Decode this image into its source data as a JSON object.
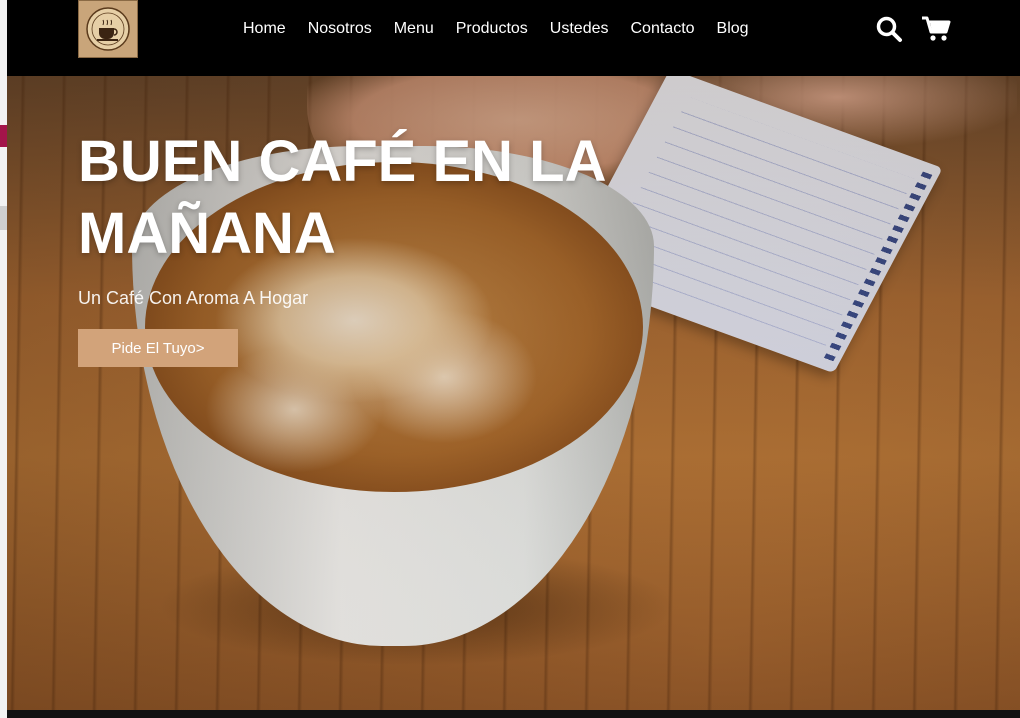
{
  "brand": {
    "logo_icon": "coffee-cup-logo"
  },
  "nav": {
    "items": [
      {
        "label": "Home"
      },
      {
        "label": "Nosotros"
      },
      {
        "label": "Menu"
      },
      {
        "label": "Productos"
      },
      {
        "label": "Ustedes"
      },
      {
        "label": "Contacto"
      },
      {
        "label": "Blog"
      }
    ],
    "icons": [
      "search-icon",
      "cart-icon"
    ]
  },
  "hero": {
    "title": "BUEN CAFÉ EN LA MAÑANA",
    "subtitle": "Un Café Con Aroma A Hogar",
    "cta_label": "Pide El Tuyo>"
  },
  "colors": {
    "header_bg": "#000000",
    "cta_bg": "#d2a37a",
    "text": "#ffffff"
  }
}
